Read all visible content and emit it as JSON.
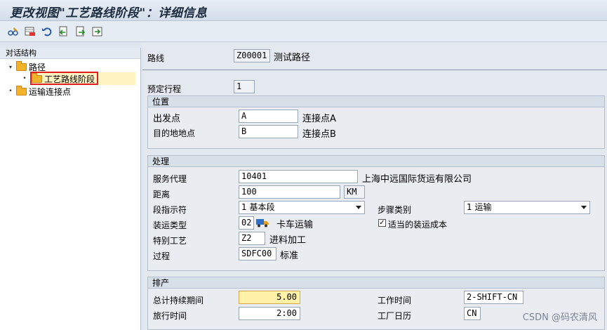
{
  "window": {
    "title": "更改视图\"工艺路线阶段\"：详细信息"
  },
  "toolbar": {
    "buttons": [
      "glasses-edit-icon",
      "delete-row-icon",
      "undo-icon",
      "previous-entry-icon",
      "next-entry-icon",
      "export-icon"
    ]
  },
  "tree": {
    "header": "对话结构",
    "items": [
      {
        "label": "路径",
        "expander": "▾"
      },
      {
        "label": "工艺路线阶段",
        "expander": "•"
      },
      {
        "label": "运输连接点",
        "expander": "•"
      }
    ]
  },
  "header_fields": {
    "route_label": "路线",
    "route_value": "Z00001",
    "route_text": "测试路径",
    "itinerary_label": "预定行程",
    "itinerary_value": "1"
  },
  "position_group": {
    "title": "位置",
    "departure_label": "出发点",
    "departure_value": "A",
    "departure_text": "连接点A",
    "destination_label": "目的地地点",
    "destination_value": "B",
    "destination_text": "连接点B"
  },
  "processing_group": {
    "title": "处理",
    "agent_label": "服务代理",
    "agent_value": "10401",
    "agent_text": "上海中远国际货运有限公司",
    "distance_label": "距离",
    "distance_value": "100",
    "distance_unit": "KM",
    "leg_label": "段指示符",
    "leg_value": "1 基本段",
    "step_label": "步骤类别",
    "step_value": "1 运输",
    "shipping_label": "装运类型",
    "shipping_value": "02",
    "shipping_text": "卡车运输",
    "cost_label": "适当的装运成本",
    "cost_checked": "✓",
    "special_label": "特别工艺",
    "special_value": "Z2",
    "special_text": "进料加工",
    "process_label": "过程",
    "process_value": "SDFC00",
    "process_text": "标准"
  },
  "schedule_group": {
    "title": "排产",
    "total_label": "总计持续期间",
    "total_value": "5.00",
    "travel_label": "旅行时间",
    "travel_value": "2:00",
    "worktime_label": "工作时间",
    "worktime_value": "2-SHIFT-CN",
    "calendar_label": "工厂日历",
    "calendar_value": "CN"
  },
  "watermark": "CSDN @码农清风",
  "colors": {
    "folder": "#f2b32b",
    "highlight_field": "#fff2a8",
    "selection_box": "#e02020"
  }
}
